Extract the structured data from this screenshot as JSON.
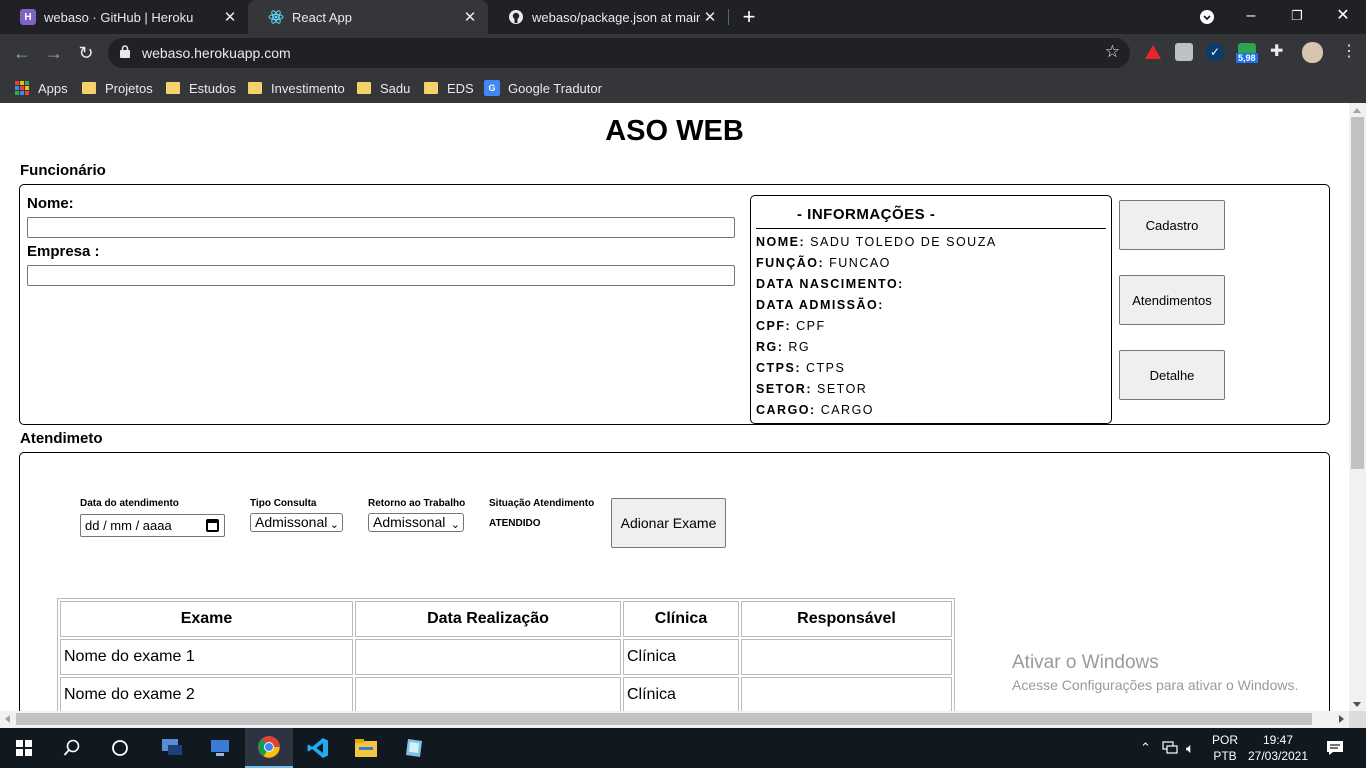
{
  "browser": {
    "tabs": [
      {
        "title": "webaso · GitHub | Heroku",
        "favicon_color": "#7f62c3",
        "favicon_letter": "H"
      },
      {
        "title": "React App",
        "favicon_color": "#61dafb"
      },
      {
        "title": "webaso/package.json at main · sa",
        "favicon_color": "#ffffff"
      }
    ],
    "url": "webaso.herokuapp.com",
    "extension_badge": "5,98",
    "bookmarks": [
      "Apps",
      "Projetos",
      "Estudos",
      "Investimento",
      "Sadu",
      "EDS",
      "Google Tradutor"
    ]
  },
  "page": {
    "title": "ASO WEB",
    "funcionario_section": "Funcionário",
    "nome_label": "Nome:",
    "empresa_label": "Empresa :",
    "info": {
      "title": "- INFORMAÇÕES -",
      "rows": [
        {
          "label": "NOME:",
          "value": "SADU TOLEDO DE SOUZA"
        },
        {
          "label": "FUNÇÃO:",
          "value": "FUNCAO"
        },
        {
          "label": "DATA NASCIMENTO:",
          "value": ""
        },
        {
          "label": "DATA ADMISSÃO:",
          "value": ""
        },
        {
          "label": "CPF:",
          "value": "CPF"
        },
        {
          "label": "RG:",
          "value": "RG"
        },
        {
          "label": "CTPS:",
          "value": "CTPS"
        },
        {
          "label": "SETOR:",
          "value": "SETOR"
        },
        {
          "label": "CARGO:",
          "value": "CARGO"
        }
      ]
    },
    "buttons": {
      "cadastro": "Cadastro",
      "atendimentos": "Atendimentos",
      "detalhe": "Detalhe"
    },
    "atendimento_section": "Atendimeto",
    "atendimento": {
      "data_label": "Data do atendimento",
      "data_placeholder": "dd / mm / aaaa",
      "tipo_label": "Tipo Consulta",
      "tipo_value": "Admissonal",
      "retorno_label": "Retorno ao Trabalho",
      "retorno_value": "Admissonal",
      "situacao_label": "Situação Atendimento",
      "situacao_value": "ATENDIDO",
      "add_exam_button": "Adionar Exame"
    },
    "table": {
      "headers": [
        "Exame",
        "Data Realização",
        "Clínica",
        "Responsável"
      ],
      "rows": [
        [
          "Nome do exame 1",
          "",
          "Clínica",
          ""
        ],
        [
          "Nome do exame 2",
          "",
          "Clínica",
          ""
        ]
      ]
    },
    "watermark": {
      "line1": "Ativar o Windows",
      "line2": "Acesse Configurações para ativar o Windows."
    }
  },
  "taskbar": {
    "lang_top": "POR",
    "lang_bottom": "PTB",
    "time": "19:47",
    "date": "27/03/2021"
  }
}
